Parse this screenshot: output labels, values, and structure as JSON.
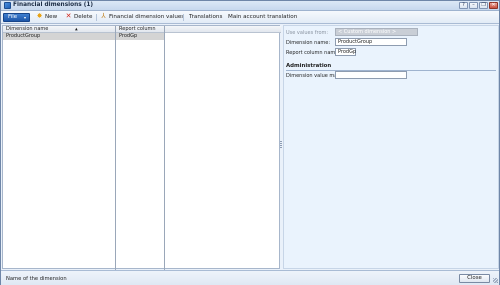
{
  "window": {
    "title": "Financial dimensions (1)",
    "help_glyph": "?",
    "minimize_glyph": "–",
    "maximize_glyph": "❐",
    "close_glyph": "✕"
  },
  "toolbar": {
    "file_label": "File",
    "file_caret": "▾",
    "new_label": "New",
    "delete_label": "Delete",
    "financial_dimension_values_label": "Financial dimension values",
    "translations_label": "Translations",
    "main_account_translation_label": "Main account translation"
  },
  "grid": {
    "columns": [
      "Dimension name",
      "Report column name"
    ],
    "sort_indicator": "▲",
    "rows": [
      {
        "dimension_name": "ProductGroup",
        "report_column_name": "ProdGp"
      }
    ]
  },
  "detail": {
    "use_values_from_label": "Use values from:",
    "use_values_from_value": "< Custom dimension >",
    "dimension_name_label": "Dimension name:",
    "dimension_name_value": "ProductGroup",
    "report_column_name_label": "Report column name:",
    "report_column_name_value": "ProdGp",
    "administration_title": "Administration",
    "dimension_value_mask_label": "Dimension value mask:",
    "dimension_value_mask_value": ""
  },
  "status": {
    "text": "Name of the dimension",
    "close_label": "Close"
  },
  "colors": {
    "file_button": "#1e56a8",
    "selected_row": "#d4d4d4",
    "detail_panel": "#eaf3fd"
  }
}
